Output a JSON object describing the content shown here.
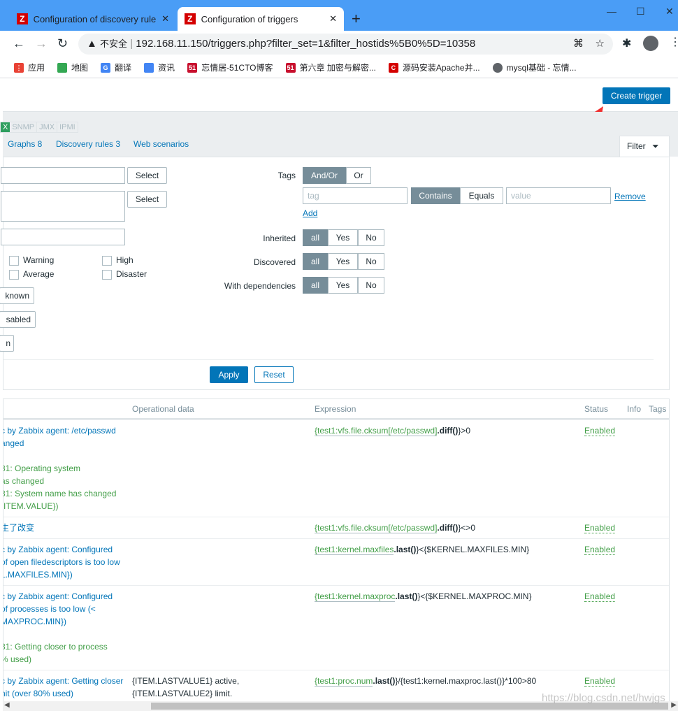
{
  "browser": {
    "tabs": [
      {
        "title": "Configuration of discovery rule",
        "active": false
      },
      {
        "title": "Configuration of triggers",
        "active": true
      }
    ],
    "new_tab": "+",
    "security": "不安全",
    "url": "192.168.11.150/triggers.php?filter_set=1&filter_hostids%5B0%5D=10358",
    "bookmarks": [
      {
        "label": "应用",
        "icon": "apps-icon"
      },
      {
        "label": "地图",
        "icon": "maps-icon"
      },
      {
        "label": "翻译",
        "icon": "translate-icon"
      },
      {
        "label": "资讯",
        "icon": "news-icon"
      },
      {
        "label": "忘情居-51CTO博客",
        "icon": "51cto-icon"
      },
      {
        "label": "第六章 加密与解密...",
        "icon": "51cto-icon"
      },
      {
        "label": "源码安装Apache并...",
        "icon": "c-icon"
      },
      {
        "label": "mysql基础 - 忘情...",
        "icon": "globe-icon"
      }
    ]
  },
  "header": {
    "create_button": "Create trigger"
  },
  "hostnav": {
    "badges": [
      "X",
      "SNMP",
      "JMX",
      "IPMI"
    ],
    "links": [
      "Graphs 8",
      "Discovery rules 3",
      "Web scenarios"
    ],
    "filter_tab": "Filter"
  },
  "filter": {
    "select": "Select",
    "severities": [
      "Warning",
      "Average",
      "High",
      "Disaster"
    ],
    "state_buttons": [
      "known",
      "sabled",
      "n"
    ],
    "tags_label": "Tags",
    "tags_ops": [
      "And/Or",
      "Or"
    ],
    "tag_placeholder": "tag",
    "tag_match": [
      "Contains",
      "Equals"
    ],
    "value_placeholder": "value",
    "remove": "Remove",
    "add": "Add",
    "rows": [
      {
        "label": "Inherited",
        "options": [
          "all",
          "Yes",
          "No"
        ]
      },
      {
        "label": "Discovered",
        "options": [
          "all",
          "Yes",
          "No"
        ]
      },
      {
        "label": "With dependencies",
        "options": [
          "all",
          "Yes",
          "No"
        ]
      }
    ],
    "apply": "Apply",
    "reset": "Reset"
  },
  "table": {
    "headers": {
      "opdata": "Operational data",
      "expression": "Expression",
      "status": "Status",
      "info": "Info",
      "tags": "Tags"
    },
    "rows": [
      {
        "name": [
          "c by Zabbix agent: /etc/passwd",
          "anged",
          ":",
          "31: Operating system",
          "as changed",
          "31: System name has changed",
          "{ITEM.VALUE})"
        ],
        "opdata": [
          "",
          ""
        ],
        "expr": {
          "item": "{test1:vfs.file.cksum[/etc/passwd]",
          "fn": ".diff()",
          "rest": "}>0"
        },
        "status": "Enabled"
      },
      {
        "name": [
          "生了改变"
        ],
        "opdata": [
          "",
          ""
        ],
        "expr": {
          "item": "{test1:vfs.file.cksum[/etc/passwd]",
          "fn": ".diff()",
          "rest": "}<>0"
        },
        "status": "Enabled"
      },
      {
        "name": [
          "c by Zabbix agent: Configured",
          " of open filedescriptors is too low",
          "L.MAXFILES.MIN})"
        ],
        "opdata": [
          "",
          ""
        ],
        "expr": {
          "item": "{test1:kernel.maxfiles",
          "fn": ".last()",
          "rest": "}<{$KERNEL.MAXFILES.MIN}"
        },
        "status": "Enabled"
      },
      {
        "name": [
          "c by Zabbix agent: Configured",
          " of processes is too low (<",
          "MAXPROC.MIN})",
          ":",
          "31: Getting closer to process",
          "% used)"
        ],
        "opdata": [
          "",
          ""
        ],
        "expr": {
          "item": "{test1:kernel.maxproc",
          "fn": ".last()",
          "rest": "}<{$KERNEL.MAXPROC.MIN}"
        },
        "status": "Enabled"
      },
      {
        "name": [
          "c by Zabbix agent: Getting closer",
          "nit (over 80% used)"
        ],
        "opdata": [
          "{ITEM.LASTVALUE1} active,",
          "{ITEM.LASTVALUE2} limit."
        ],
        "expr": {
          "item": "{test1:proc.num",
          "fn": ".last()",
          "rest": "}/{test1:kernel.maxproc.last()}*100>80"
        },
        "status": "Enabled"
      }
    ]
  },
  "watermark": "https://blog.csdn.net/hwjgs"
}
